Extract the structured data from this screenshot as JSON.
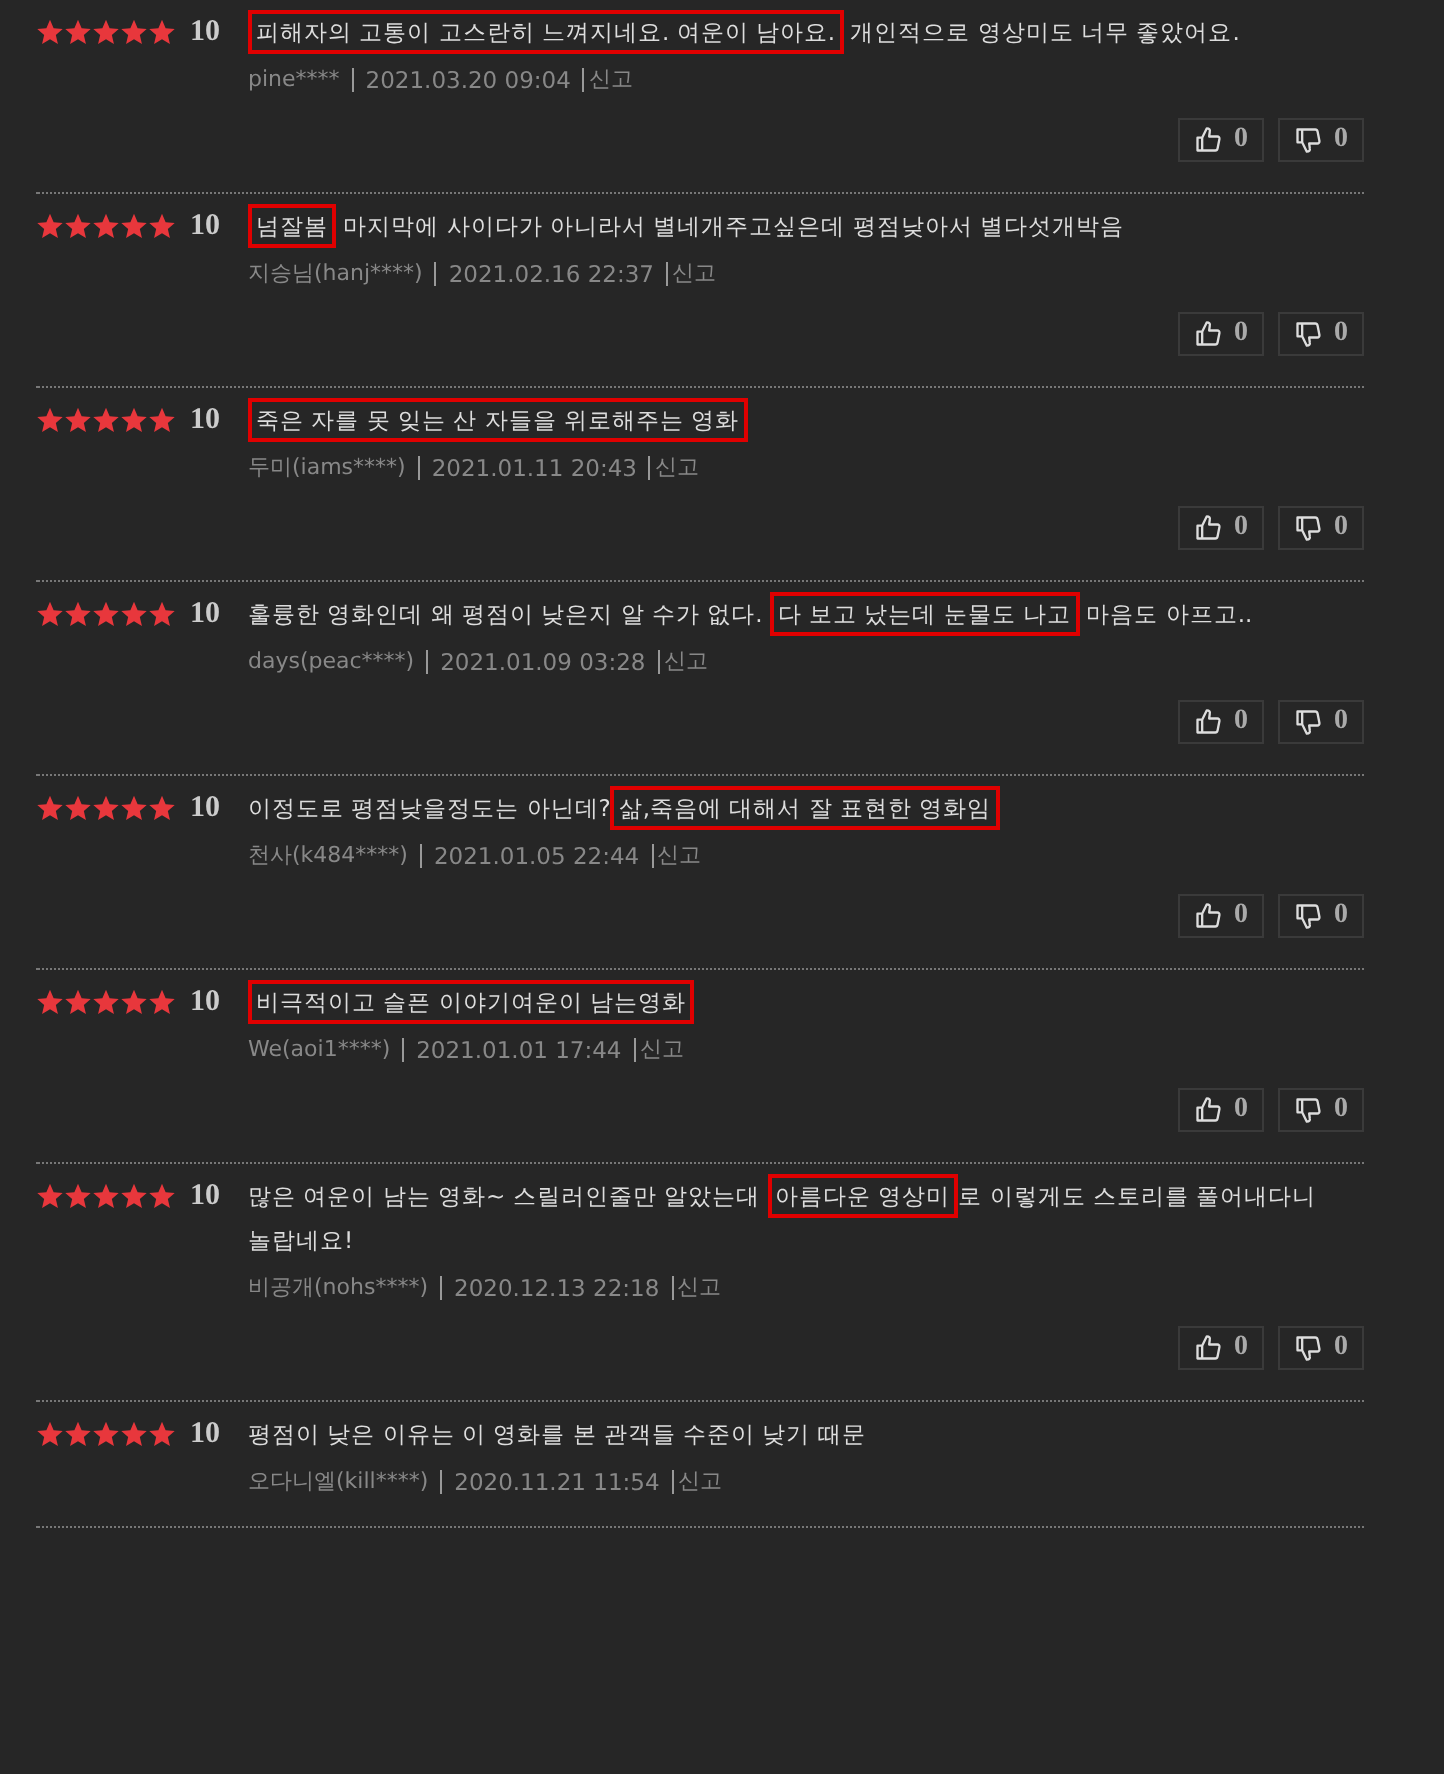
{
  "reviews": [
    {
      "stars": 5,
      "score": "10",
      "parts": [
        {
          "text": "피해자의 고통이 고스란히 느껴지네요. 여운이 남아요.",
          "highlighted": true
        },
        {
          "text": " 개인적으로 영상미도 너무 좋았어요.",
          "highlighted": false
        }
      ],
      "author": "pine****",
      "date": "2021.03.20 09:04",
      "report": "신고",
      "likes": "0",
      "dislikes": "0"
    },
    {
      "stars": 5,
      "score": "10",
      "parts": [
        {
          "text": "넘잘봄",
          "highlighted": true
        },
        {
          "text": " 마지막에 사이다가 아니라서 별네개주고싶은데 평점낮아서 별다섯개박음",
          "highlighted": false
        }
      ],
      "author": "지승님(hanj****)",
      "date": "2021.02.16 22:37",
      "report": "신고",
      "likes": "0",
      "dislikes": "0"
    },
    {
      "stars": 5,
      "score": "10",
      "parts": [
        {
          "text": "죽은 자를 못 잊는 산 자들을 위로해주는 영화",
          "highlighted": true
        }
      ],
      "author": "두미(iams****)",
      "date": "2021.01.11 20:43",
      "report": "신고",
      "likes": "0",
      "dislikes": "0"
    },
    {
      "stars": 5,
      "score": "10",
      "parts": [
        {
          "text": "훌륭한 영화인데 왜 평점이 낮은지 알 수가 없다. ",
          "highlighted": false
        },
        {
          "text": "다 보고 났는데 눈물도 나고",
          "highlighted": true
        },
        {
          "text": " 마음도 아프고..",
          "highlighted": false
        }
      ],
      "author": "days(peac****)",
      "date": "2021.01.09 03:28",
      "report": "신고",
      "likes": "0",
      "dislikes": "0"
    },
    {
      "stars": 5,
      "score": "10",
      "parts": [
        {
          "text": "이정도로 평점낮을정도는 아닌데?",
          "highlighted": false
        },
        {
          "text": "삶,죽음에 대해서 잘 표현한 영화임",
          "highlighted": true
        }
      ],
      "author": "천사(k484****)",
      "date": "2021.01.05 22:44",
      "report": "신고",
      "likes": "0",
      "dislikes": "0"
    },
    {
      "stars": 5,
      "score": "10",
      "parts": [
        {
          "text": "비극적이고 슬픈 이야기여운이 남는영화",
          "highlighted": true
        }
      ],
      "author": "We(aoi1****)",
      "date": "2021.01.01 17:44",
      "report": "신고",
      "likes": "0",
      "dislikes": "0"
    },
    {
      "stars": 5,
      "score": "10",
      "parts": [
        {
          "text": "많은 여운이 남는 영화~ 스릴러인줄만 알았는대 ",
          "highlighted": false
        },
        {
          "text": "아름다운 영상미",
          "highlighted": true
        },
        {
          "text": "로 이렇게도 스토리를 풀어내다니 놀랍네요!",
          "highlighted": false
        }
      ],
      "author": "비공개(nohs****)",
      "date": "2020.12.13 22:18",
      "report": "신고",
      "likes": "0",
      "dislikes": "0"
    },
    {
      "stars": 5,
      "score": "10",
      "parts": [
        {
          "text": "평점이 낮은 이유는 이 영화를 본 관객들 수준이 낮기 때문",
          "highlighted": false
        }
      ],
      "author": "오다니엘(kill****)",
      "date": "2020.11.21 11:54",
      "report": "신고"
    }
  ]
}
